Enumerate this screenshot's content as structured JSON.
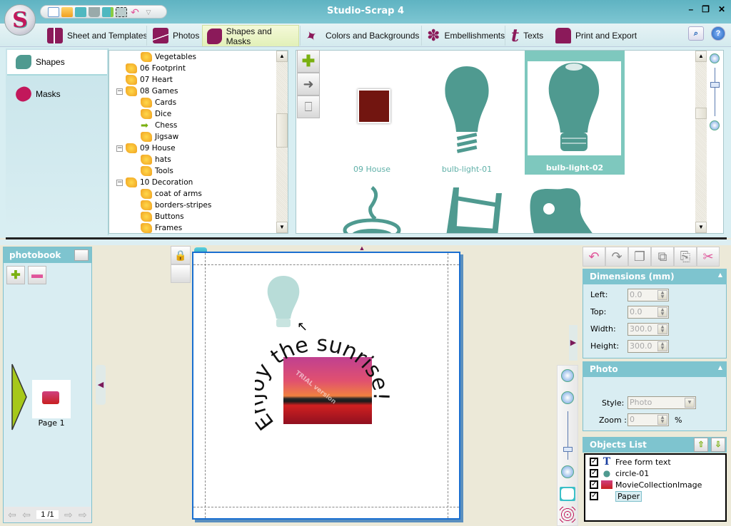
{
  "window": {
    "title": "Studio-Scrap 4",
    "controls": [
      "minimize",
      "restore",
      "close"
    ]
  },
  "quick_access": {
    "icons": [
      "new-document-icon",
      "open-folder-icon",
      "save-icon",
      "cart-icon",
      "save-as-icon",
      "print-preview-icon",
      "undo-icon",
      "dropdown-icon"
    ]
  },
  "ribbon": {
    "tabs": [
      {
        "label": "Sheet and Templates",
        "icon": "sheet-icon",
        "active": false
      },
      {
        "label": "Photos",
        "icon": "photo-icon",
        "active": false
      },
      {
        "label": "Shapes and Masks",
        "icon": "puzzle-icon",
        "active": true
      },
      {
        "label": "Colors and Backgrounds",
        "icon": "brush-icon",
        "active": false
      },
      {
        "label": "Embellishments",
        "icon": "star-icon",
        "active": false
      },
      {
        "label": "Texts",
        "icon": "text-icon",
        "active": false
      },
      {
        "label": "Print and Export",
        "icon": "printer-icon",
        "active": false
      }
    ],
    "right_icons": [
      "search-icon",
      "help-icon"
    ]
  },
  "left_nav": {
    "items": [
      {
        "label": "Shapes",
        "active": true
      },
      {
        "label": "Masks",
        "active": false
      }
    ]
  },
  "tree": {
    "items": [
      {
        "label": "Vegetables",
        "level": 2,
        "icon": "puzzle"
      },
      {
        "label": "06 Footprint",
        "level": 1,
        "icon": "puzzle"
      },
      {
        "label": "07 Heart",
        "level": 1,
        "icon": "puzzle"
      },
      {
        "label": "08 Games",
        "level": 1,
        "icon": "puzzle",
        "expanded": true
      },
      {
        "label": "Cards",
        "level": 2,
        "icon": "puzzle"
      },
      {
        "label": "Dice",
        "level": 2,
        "icon": "puzzle"
      },
      {
        "label": "Chess",
        "level": 2,
        "icon": "arrow"
      },
      {
        "label": "Jigsaw",
        "level": 2,
        "icon": "puzzle"
      },
      {
        "label": "09 House",
        "level": 1,
        "icon": "puzzle",
        "expanded": true
      },
      {
        "label": "hats",
        "level": 2,
        "icon": "puzzle"
      },
      {
        "label": "Tools",
        "level": 2,
        "icon": "puzzle"
      },
      {
        "label": "10 Decoration",
        "level": 1,
        "icon": "puzzle",
        "expanded": true
      },
      {
        "label": "coat of arms",
        "level": 2,
        "icon": "puzzle"
      },
      {
        "label": "borders-stripes",
        "level": 2,
        "icon": "puzzle"
      },
      {
        "label": "Buttons",
        "level": 2,
        "icon": "puzzle"
      },
      {
        "label": "Frames",
        "level": 2,
        "icon": "puzzle"
      }
    ]
  },
  "gallery": {
    "tools": [
      "add-icon",
      "apply-arrow-icon",
      "trash-icon"
    ],
    "items": [
      {
        "label": "09 House",
        "selected": false
      },
      {
        "label": "bulb-light-01",
        "selected": false
      },
      {
        "label": "bulb-light-02",
        "selected": true
      },
      {
        "label": "",
        "selected": false
      },
      {
        "label": "",
        "selected": false
      },
      {
        "label": "",
        "selected": false
      }
    ],
    "folder_color": "#721510",
    "shape_color": "#4f9a90"
  },
  "photobook": {
    "title": "photobook",
    "pages": [
      {
        "label": "Page 1"
      }
    ],
    "pager": {
      "current": "1",
      "separator": "/1"
    }
  },
  "canvas": {
    "curved_text": "Enjoy the sunrise!",
    "watermark": "TRIAL version"
  },
  "edit_toolbar": {
    "buttons": [
      "undo-icon",
      "redo-icon",
      "copy-icon",
      "duplicate-icon",
      "paste-icon",
      "cut-icon"
    ]
  },
  "dimensions": {
    "title": "Dimensions (mm)",
    "fields": [
      {
        "label": "Left:",
        "value": "0.0"
      },
      {
        "label": "Top:",
        "value": "0.0"
      },
      {
        "label": "Width:",
        "value": "300.0"
      },
      {
        "label": "Height:",
        "value": "300.0"
      }
    ]
  },
  "photo": {
    "title": "Photo",
    "style_label": "Style:",
    "style_value": "Photo",
    "zoom_label": "Zoom :",
    "zoom_value": "0",
    "zoom_unit": "%"
  },
  "objects": {
    "title": "Objects List",
    "items": [
      {
        "label": "Free form text",
        "checked": true,
        "icon": "text-object-icon"
      },
      {
        "label": "circle-01",
        "checked": true,
        "icon": "shape-object-icon"
      },
      {
        "label": "MovieCollectionImage",
        "checked": true,
        "icon": "image-object-icon"
      },
      {
        "label": "Paper",
        "checked": true,
        "icon": "",
        "selected": true
      }
    ]
  }
}
